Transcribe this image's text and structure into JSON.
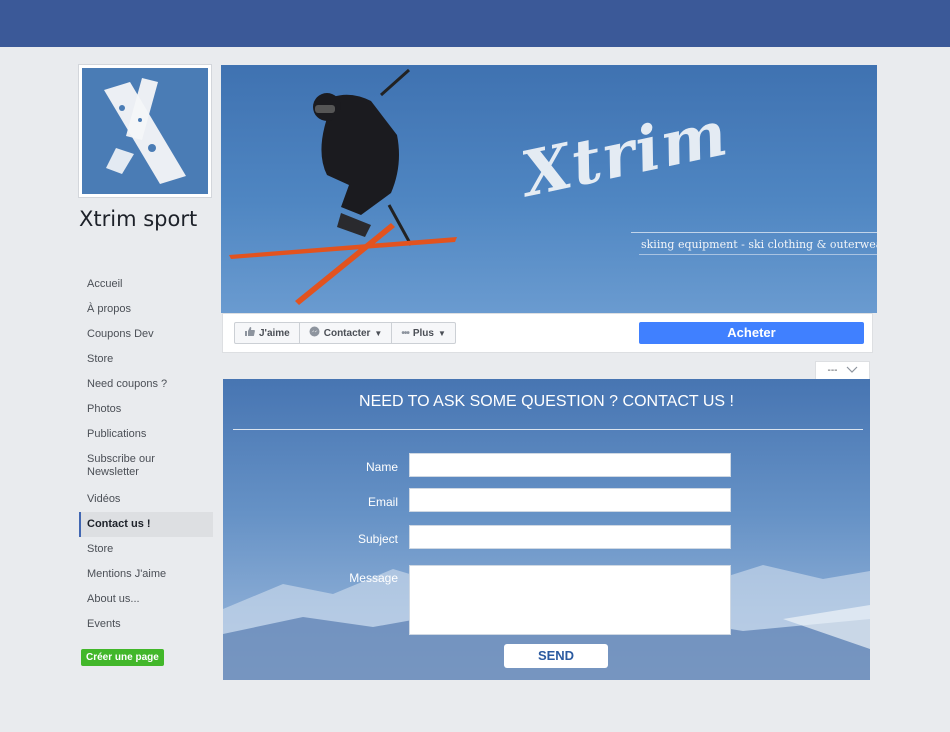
{
  "page": {
    "name": "Xtrim sport"
  },
  "cover": {
    "brand": "Xtrim",
    "tagline": "skiing equipment - ski clothing & outerwear"
  },
  "sidebar": {
    "items": [
      {
        "label": "Accueil"
      },
      {
        "label": "À propos"
      },
      {
        "label": "Coupons Dev"
      },
      {
        "label": "Store"
      },
      {
        "label": "Need coupons ?"
      },
      {
        "label": "Photos"
      },
      {
        "label": "Publications"
      },
      {
        "label": "Subscribe our Newsletter"
      },
      {
        "label": "Vidéos"
      },
      {
        "label": "Contact us !"
      },
      {
        "label": "Store"
      },
      {
        "label": "Mentions J'aime"
      },
      {
        "label": "About us..."
      },
      {
        "label": "Events"
      }
    ],
    "active_index": 9,
    "create_page": "Créer une page"
  },
  "actions": {
    "like": "J'aime",
    "contact": "Contacter",
    "more": "Plus",
    "buy": "Acheter",
    "tab_select": "---"
  },
  "contact_form": {
    "title": "NEED TO ASK SOME QUESTION ? CONTACT US !",
    "name_label": "Name",
    "email_label": "Email",
    "subject_label": "Subject",
    "message_label": "Message",
    "name_value": "",
    "email_value": "",
    "subject_value": "",
    "message_value": "",
    "send_label": "SEND"
  },
  "colors": {
    "topbar": "#3b5998",
    "buy_button": "#4080ff",
    "create_page_button": "#42b72a",
    "contact_panel": "#5580bc"
  }
}
